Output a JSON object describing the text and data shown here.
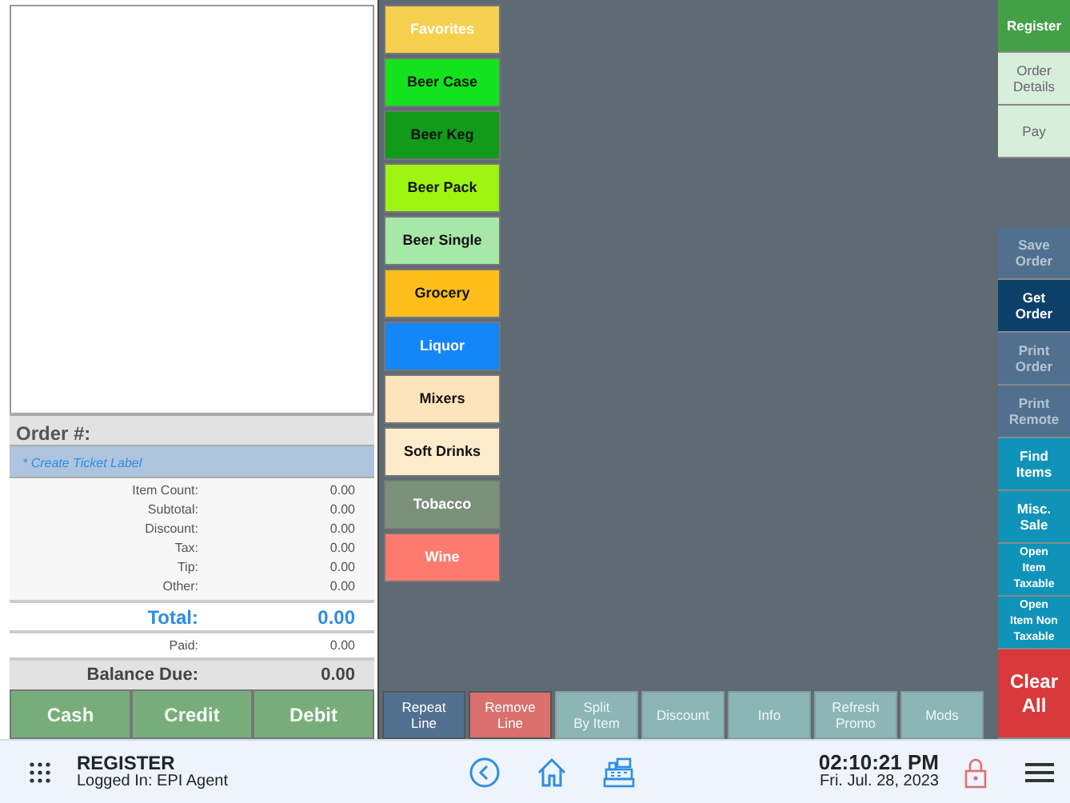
{
  "order": {
    "number_label": "Order #:",
    "ticket_label": "* Create Ticket Label",
    "summary": [
      {
        "label": "Item Count:",
        "value": "0.00"
      },
      {
        "label": "Subtotal:",
        "value": "0.00"
      },
      {
        "label": "Discount:",
        "value": "0.00"
      },
      {
        "label": "Tax:",
        "value": "0.00"
      },
      {
        "label": "Tip:",
        "value": "0.00"
      },
      {
        "label": "Other:",
        "value": "0.00"
      }
    ],
    "total": {
      "label": "Total:",
      "value": "0.00"
    },
    "paid": {
      "label": "Paid:",
      "value": "0.00"
    },
    "balance": {
      "label": "Balance Due:",
      "value": "0.00"
    },
    "payments": [
      {
        "label": "Cash",
        "disabled": true
      },
      {
        "label": "Credit",
        "disabled": true
      },
      {
        "label": "Debit",
        "disabled": true
      }
    ]
  },
  "categories": [
    {
      "label": "Favorites",
      "color": "#f7cf4f",
      "kind": "light"
    },
    {
      "label": "Beer Case",
      "color": "#13e31c",
      "kind": "dark"
    },
    {
      "label": "Beer Keg",
      "color": "#129a1a",
      "kind": "dark"
    },
    {
      "label": "Beer Pack",
      "color": "#9ef511",
      "kind": "dark"
    },
    {
      "label": "Beer Single",
      "color": "#a7e8a9",
      "kind": "dark"
    },
    {
      "label": "Grocery",
      "color": "#fdbe1c",
      "kind": "dark"
    },
    {
      "label": "Liquor",
      "color": "#1486f7",
      "kind": "light"
    },
    {
      "label": "Mixers",
      "color": "#fee4bb",
      "kind": "dark"
    },
    {
      "label": "Soft Drinks",
      "color": "#feebcb",
      "kind": "dark"
    },
    {
      "label": "Tobacco",
      "color": "#7a9079",
      "kind": "light"
    },
    {
      "label": "Wine",
      "color": "#fc7b6e",
      "kind": "light"
    }
  ],
  "toolbar": [
    {
      "label": "Repeat\nLine",
      "color": "#51708f",
      "disabled": false
    },
    {
      "label": "Remove\nLine",
      "color": "#d9706d",
      "disabled": false
    },
    {
      "label": "Split\nBy Item",
      "color": "#8bb6b4",
      "disabled": true
    },
    {
      "label": "Discount",
      "color": "#8bb6b4",
      "disabled": true
    },
    {
      "label": "Info",
      "color": "#8bb6b4",
      "disabled": true
    },
    {
      "label": "Refresh\nPromo",
      "color": "#8bb6b4",
      "disabled": true
    },
    {
      "label": "Mods",
      "color": "#8bb6b4",
      "disabled": true
    }
  ],
  "side_top": [
    {
      "label": "Register",
      "color": "#43a047",
      "selected": true
    },
    {
      "label": "Order\nDetails",
      "color": "#d7eedb",
      "selected": false
    },
    {
      "label": "Pay",
      "color": "#d7eedb",
      "selected": false
    }
  ],
  "side_actions": [
    {
      "label": "Save\nOrder",
      "color": "#51708f",
      "disabled": true,
      "kind": "normal"
    },
    {
      "label": "Get\nOrder",
      "color": "#0d3f6b",
      "disabled": false,
      "kind": "normal"
    },
    {
      "label": "Print\nOrder",
      "color": "#51708f",
      "disabled": true,
      "kind": "normal"
    },
    {
      "label": "Print\nRemote",
      "color": "#51708f",
      "disabled": true,
      "kind": "normal"
    },
    {
      "label": "Find\nItems",
      "color": "#0f93b9",
      "disabled": false,
      "kind": "normal"
    },
    {
      "label": "Misc.\nSale",
      "color": "#0f93b9",
      "disabled": false,
      "kind": "normal"
    },
    {
      "label": "Open\nItem\nTaxable",
      "color": "#0f93b9",
      "disabled": false,
      "kind": "small"
    },
    {
      "label": "Open\nItem Non\nTaxable",
      "color": "#0f93b9",
      "disabled": false,
      "kind": "small"
    },
    {
      "label": "Clear\nAll",
      "color": "#d8393a",
      "disabled": false,
      "kind": "large"
    }
  ],
  "footer": {
    "title": "REGISTER",
    "user": "Logged In:  EPI Agent",
    "time": "02:10:21 PM",
    "date": "Fri. Jul. 28, 2023"
  }
}
